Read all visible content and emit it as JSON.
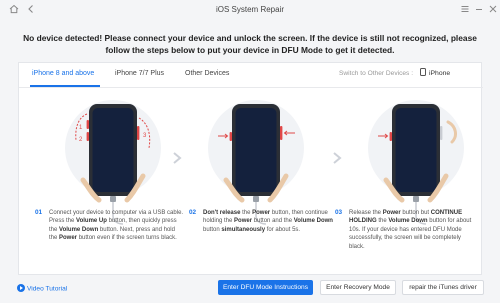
{
  "window": {
    "title": "iOS System Repair",
    "controls": [
      "home-icon",
      "back-icon",
      "menu-icon",
      "minimize-icon",
      "close-icon"
    ]
  },
  "headline": {
    "line1": "No device detected! Please connect your device and unlock the screen. If the device is still not recognized, please",
    "line2": "follow the steps below to put your device in DFU Mode to get it detected."
  },
  "tabs": [
    {
      "label": "iPhone 8 and above",
      "active": true
    },
    {
      "label": "iPhone 7/7 Plus",
      "active": false
    },
    {
      "label": "Other Devices",
      "active": false
    }
  ],
  "device_switch": {
    "label": "Switch to Other Devices :",
    "selected": "iPhone"
  },
  "steps": [
    {
      "num": "01",
      "parts": [
        {
          "t": "Connect your device to computer via a USB cable. Press the ",
          "b": false
        },
        {
          "t": "Volume Up",
          "b": true
        },
        {
          "t": " button, then quickly press the ",
          "b": false
        },
        {
          "t": "Volume Down",
          "b": true
        },
        {
          "t": " button. Next, press and hold the ",
          "b": false
        },
        {
          "t": "Power",
          "b": true
        },
        {
          "t": " button even if the screen turns black.",
          "b": false
        }
      ]
    },
    {
      "num": "02",
      "parts": [
        {
          "t": "Don't release",
          "b": true
        },
        {
          "t": " the ",
          "b": false
        },
        {
          "t": "Power",
          "b": true
        },
        {
          "t": " button, then continue holding the ",
          "b": false
        },
        {
          "t": "Power",
          "b": true
        },
        {
          "t": " button and the ",
          "b": false
        },
        {
          "t": "Volume Down",
          "b": true
        },
        {
          "t": " button ",
          "b": false
        },
        {
          "t": "simultaneously",
          "b": true
        },
        {
          "t": " for about 5s.",
          "b": false
        }
      ]
    },
    {
      "num": "03",
      "parts": [
        {
          "t": "Release the ",
          "b": false
        },
        {
          "t": "Power",
          "b": true
        },
        {
          "t": " button but ",
          "b": false
        },
        {
          "t": "CONTINUE HOLDING",
          "b": true
        },
        {
          "t": " the ",
          "b": false
        },
        {
          "t": "Volume Down",
          "b": true
        },
        {
          "t": " button for about 10s. If your device has entered DFU Mode successfully, the screen will be completely black.",
          "b": false
        }
      ]
    }
  ],
  "footer": {
    "video_label": "Video Tutorial",
    "buttons": {
      "dfu": "Enter DFU Mode Instructions",
      "recovery": "Enter Recovery Mode",
      "repair": "repair the iTunes driver"
    }
  },
  "colors": {
    "accent": "#1a73e8",
    "phone_screen": "#14213d",
    "button_red": "#e04848"
  }
}
